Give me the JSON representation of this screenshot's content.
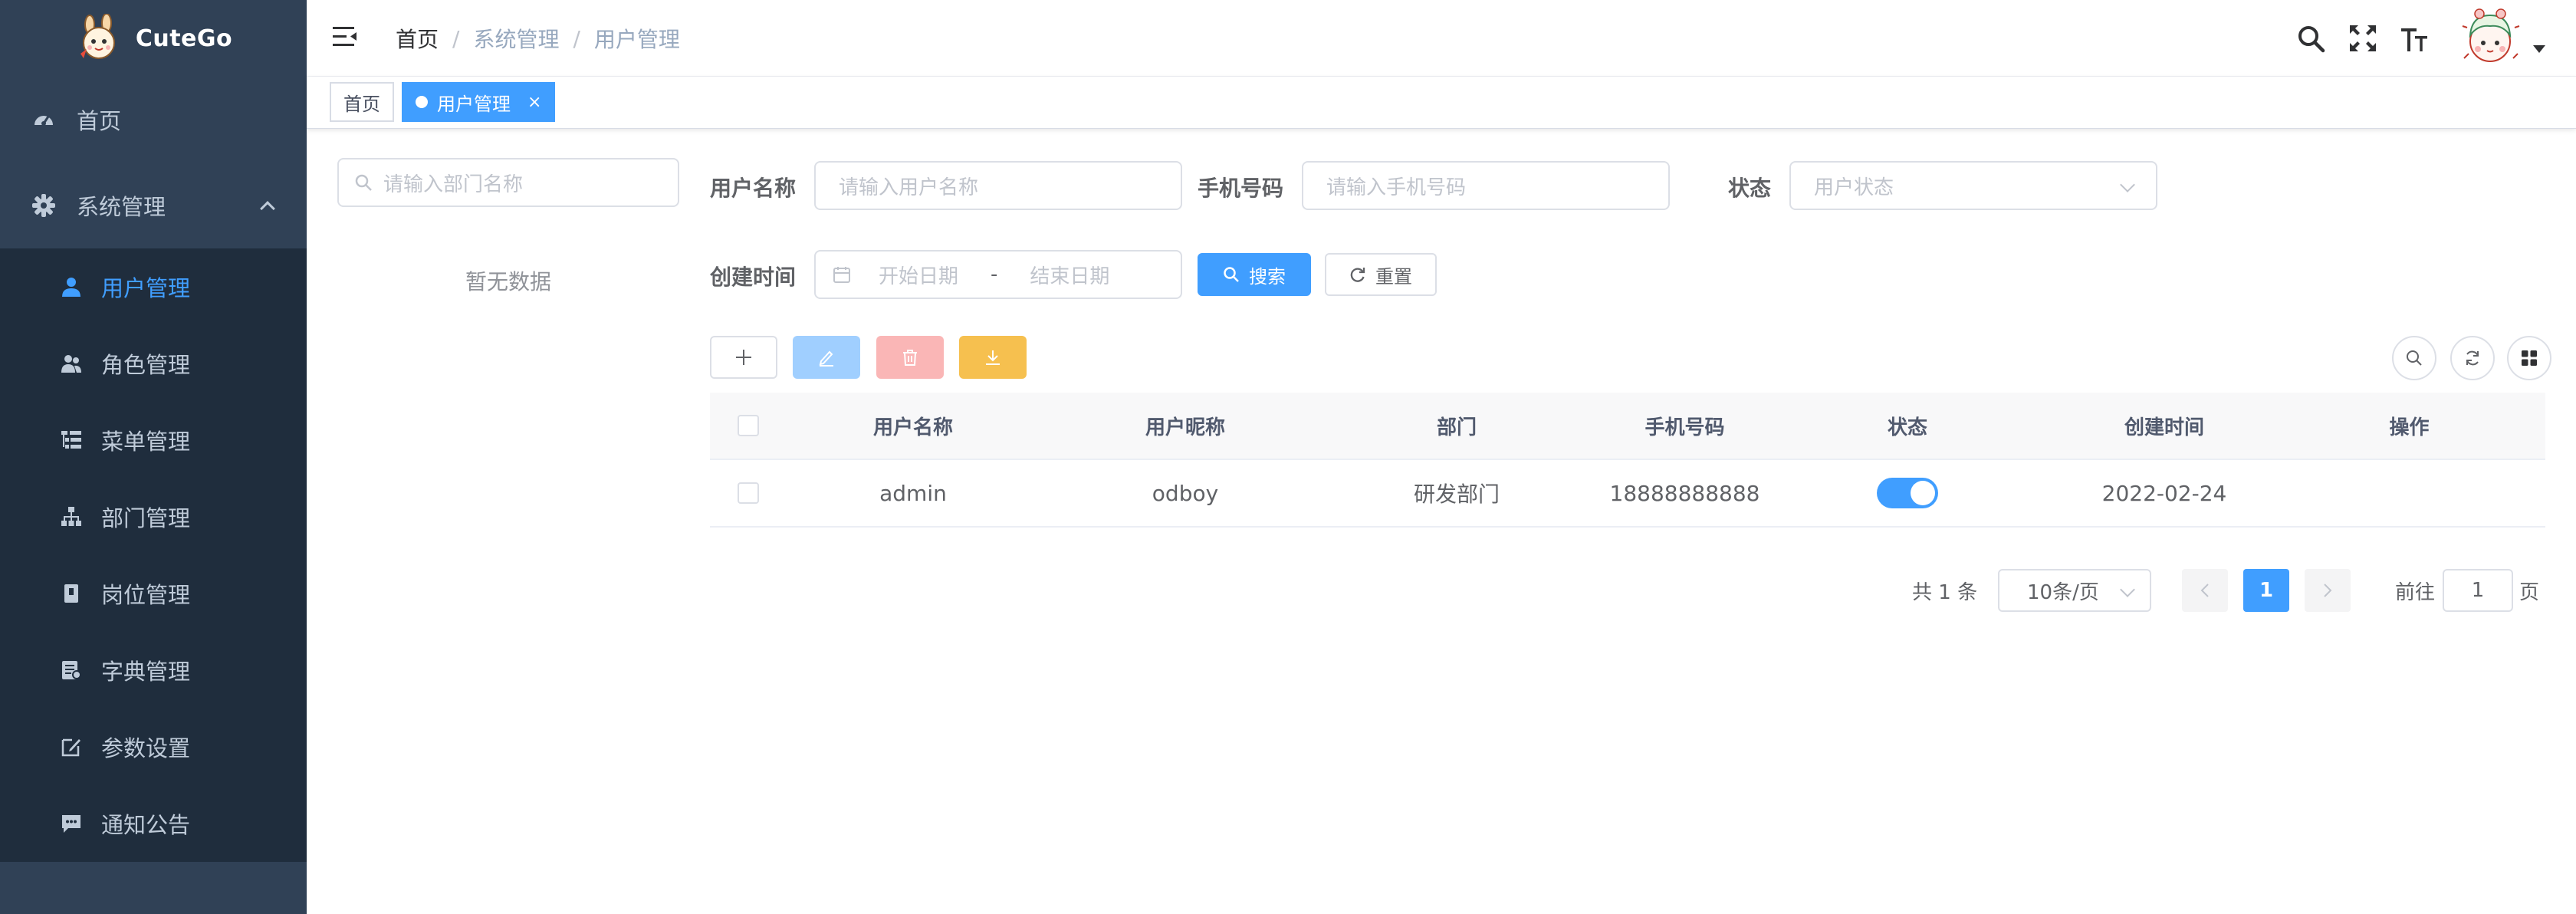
{
  "app": {
    "name": "CuteGo"
  },
  "sidebar": {
    "items": [
      {
        "label": "首页",
        "icon": "dashboard-icon"
      },
      {
        "label": "系统管理",
        "icon": "gear-icon",
        "expanded": true
      }
    ],
    "submenu": [
      {
        "label": "用户管理",
        "icon": "user-icon",
        "active": true
      },
      {
        "label": "角色管理",
        "icon": "peoples-icon"
      },
      {
        "label": "菜单管理",
        "icon": "tree-table-icon"
      },
      {
        "label": "部门管理",
        "icon": "tree-icon"
      },
      {
        "label": "岗位管理",
        "icon": "post-icon"
      },
      {
        "label": "字典管理",
        "icon": "dict-icon"
      },
      {
        "label": "参数设置",
        "icon": "edit-icon"
      },
      {
        "label": "通知公告",
        "icon": "message-icon"
      }
    ]
  },
  "breadcrumb": [
    "首页",
    "系统管理",
    "用户管理"
  ],
  "tags": [
    {
      "label": "首页",
      "active": false
    },
    {
      "label": "用户管理",
      "active": true,
      "close": "×"
    }
  ],
  "dept": {
    "placeholder": "请输入部门名称",
    "empty": "暂无数据"
  },
  "query": {
    "username_label": "用户名称",
    "username_placeholder": "请输入用户名称",
    "phone_label": "手机号码",
    "phone_placeholder": "请输入手机号码",
    "status_label": "状态",
    "status_placeholder": "用户状态",
    "time_label": "创建时间",
    "start_placeholder": "开始日期",
    "range_sep": "-",
    "end_placeholder": "结束日期",
    "search_btn": "搜索",
    "reset_btn": "重置"
  },
  "table": {
    "headers": [
      "用户名称",
      "用户昵称",
      "部门",
      "手机号码",
      "状态",
      "创建时间",
      "操作"
    ],
    "rows": [
      {
        "username": "admin",
        "nickname": "odboy",
        "dept": "研发部门",
        "phone": "18888888888",
        "status_on": true,
        "created": "2022-02-24",
        "ops": ""
      }
    ]
  },
  "pagination": {
    "total": "共 1 条",
    "page_size": "10条/页",
    "current": "1",
    "goto": "前往",
    "jump_value": "1",
    "page_unit": "页"
  },
  "colors": {
    "sidebar_bg": "#304156",
    "submenu_bg": "#1f2d3d",
    "primary": "#409eff",
    "danger_light": "#fab6b6",
    "warning": "#f6c04f"
  }
}
